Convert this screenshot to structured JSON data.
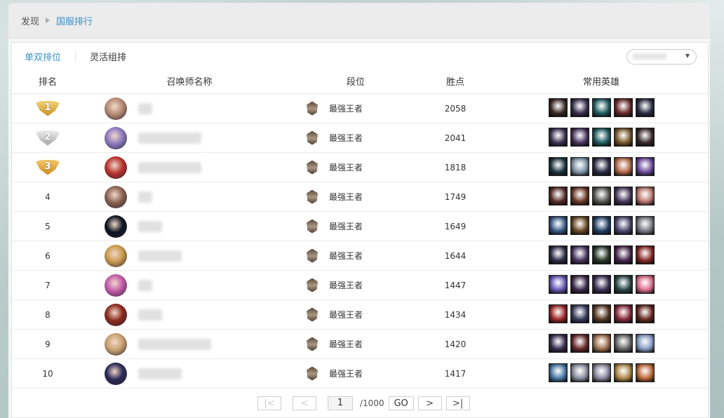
{
  "breadcrumb": {
    "home": "发现",
    "current": "国服排行"
  },
  "tabs": [
    {
      "label": "单双排位",
      "active": true
    },
    {
      "label": "灵活组排",
      "active": false
    }
  ],
  "columns": {
    "rank": "排名",
    "name": "召唤师名称",
    "tier": "段位",
    "points": "胜点",
    "heroes": "常用英雄"
  },
  "rows": [
    {
      "rank": "1",
      "medal": "gold",
      "tier": "最强王者",
      "points": "2058",
      "avatar": "#b58a73",
      "name_len": 1,
      "heroes": [
        "#3b2a24",
        "#3a3050",
        "#1f5f63",
        "#6b2b2b",
        "#2a2f45"
      ]
    },
    {
      "rank": "2",
      "medal": "silver",
      "tier": "最强王者",
      "points": "2041",
      "avatar": "#8b7ac0",
      "name_len": 6,
      "heroes": [
        "#3e3454",
        "#4a3561",
        "#1f5f63",
        "#7a5a2c",
        "#3a2a2a"
      ]
    },
    {
      "rank": "3",
      "medal": "bronze",
      "tier": "最强王者",
      "points": "1818",
      "avatar": "#b8322e",
      "name_len": 6,
      "heroes": [
        "#1d3540",
        "#7f96a8",
        "#2a2f48",
        "#b56a4a",
        "#6f4ca0"
      ]
    },
    {
      "rank": "4",
      "medal": "",
      "tier": "最强王者",
      "points": "1749",
      "avatar": "#8a6150",
      "name_len": 1,
      "heroes": [
        "#5a2f2a",
        "#6b3a28",
        "#5a5a52",
        "#4a3b60",
        "#c07a72"
      ]
    },
    {
      "rank": "5",
      "medal": "",
      "tier": "最强王者",
      "points": "1649",
      "avatar": "#0e1520",
      "name_len": 2,
      "heroes": [
        "#3a5d8a",
        "#6a4a25",
        "#24436a",
        "#4c4a70",
        "#7a7a85"
      ]
    },
    {
      "rank": "6",
      "medal": "",
      "tier": "最强王者",
      "points": "1644",
      "avatar": "#c99a4e",
      "name_len": 4,
      "heroes": [
        "#2e2e48",
        "#4a3560",
        "#2a3a2a",
        "#4a2a52",
        "#8a2a28"
      ]
    },
    {
      "rank": "7",
      "medal": "",
      "tier": "最强王者",
      "points": "1447",
      "avatar": "#c25aa8",
      "name_len": 1,
      "heroes": [
        "#6a5ab8",
        "#3a2a48",
        "#3a2f55",
        "#2a4a48",
        "#e07090"
      ]
    },
    {
      "rank": "8",
      "medal": "",
      "tier": "最强王者",
      "points": "1434",
      "avatar": "#8a2a1e",
      "name_len": 2,
      "heroes": [
        "#a02a2a",
        "#3a3f60",
        "#5a3a22",
        "#8a2a3a",
        "#6a2a22"
      ]
    },
    {
      "rank": "9",
      "medal": "",
      "tier": "最强王者",
      "points": "1420",
      "avatar": "#c8a070",
      "name_len": 7,
      "heroes": [
        "#3a2f50",
        "#6a2a2a",
        "#a07050",
        "#6a6a6a",
        "#8aa0c8"
      ]
    },
    {
      "rank": "10",
      "medal": "",
      "tier": "最强王者",
      "points": "1417",
      "avatar": "#2a2a55",
      "name_len": 4,
      "heroes": [
        "#4a7aa8",
        "#8a90a0",
        "#8a8aa0",
        "#b08a4a",
        "#c06a3a"
      ]
    }
  ],
  "pager": {
    "page": "1",
    "total": "/1000",
    "go": "GO",
    "first": "|<",
    "prev": "<",
    "next": ">",
    "last": ">|"
  }
}
